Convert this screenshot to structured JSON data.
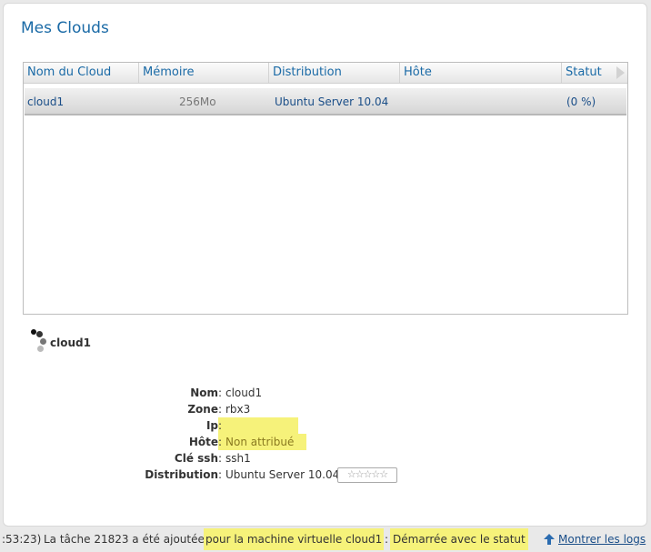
{
  "panel": {
    "title": "Mes Clouds"
  },
  "grid": {
    "columns": [
      "Nom du Cloud",
      "Mémoire",
      "Distribution",
      "Hôte",
      "Statut"
    ],
    "rows": [
      {
        "name": "cloud1",
        "memory": "256Mo",
        "distribution": "Ubuntu Server 10.04",
        "host": "",
        "status": "(0 %)"
      }
    ]
  },
  "vm": {
    "name": "cloud1",
    "details": [
      {
        "label": "Nom",
        "value": "cloud1"
      },
      {
        "label": "Zone",
        "value": "rbx3"
      },
      {
        "label": "Ip",
        "value": ""
      },
      {
        "label": "Hôte",
        "value": "Non attribué"
      },
      {
        "label": "Clé ssh",
        "value": "ssh1"
      },
      {
        "label": "Distribution",
        "value": "Ubuntu Server 10.04"
      }
    ],
    "rating": {
      "stars": 5,
      "filled": 0,
      "glyphs": "☆☆☆☆☆"
    }
  },
  "statusbar": {
    "time": ":53:23)",
    "task": "La tâche 21823 a été ajoutée",
    "target": "pour la machine virtuelle cloud1",
    "colon": ":",
    "state": "Démarrée avec le statut",
    "logs_label": "Montrer les logs"
  },
  "colors": {
    "accent": "#1a6aa6",
    "highlight": "#f6f27a",
    "link": "#1a4e88"
  }
}
